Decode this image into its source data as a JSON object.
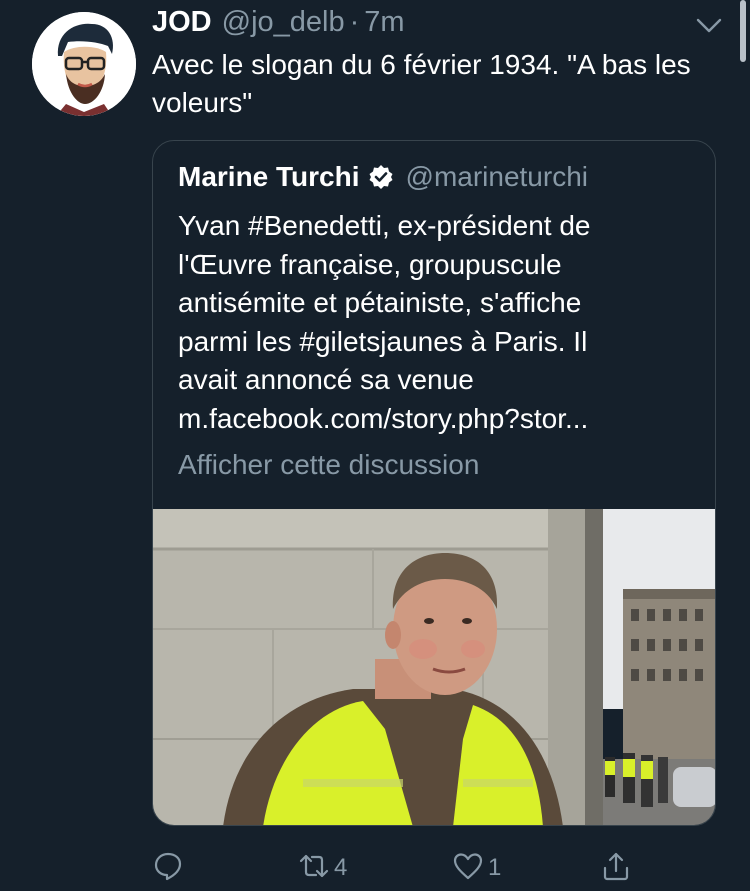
{
  "tweet": {
    "author_name": "JOD",
    "author_handle": "@jo_delb",
    "separator": "·",
    "time": "7m",
    "text": "Avec le slogan du 6 février 1934. \"A bas les voleurs\""
  },
  "quoted_tweet": {
    "author_name": "Marine Turchi",
    "author_handle": "@marineturchi",
    "verified": true,
    "text_lines": [
      "Yvan #Benedetti, ex-président de",
      "l'Œuvre française, groupuscule",
      "antisémite et pétainiste, s'affiche",
      "parmi les #giletsjaunes à Paris. Il",
      "avait annoncé sa venue",
      "m.facebook.com/story.php?stor..."
    ],
    "show_thread_label": "Afficher cette discussion"
  },
  "actions": {
    "reply_count": "",
    "retweet_count": "4",
    "like_count": "1"
  },
  "icons": {
    "reply": "reply-icon",
    "retweet": "retweet-icon",
    "like": "heart-icon",
    "share": "share-icon",
    "menu": "chevron-down-icon",
    "verified": "verified-badge-icon"
  },
  "colors": {
    "background": "#15202b",
    "secondary_text": "#8899a6",
    "border": "#38444d",
    "high_vis_vest": "#d9f02a"
  }
}
